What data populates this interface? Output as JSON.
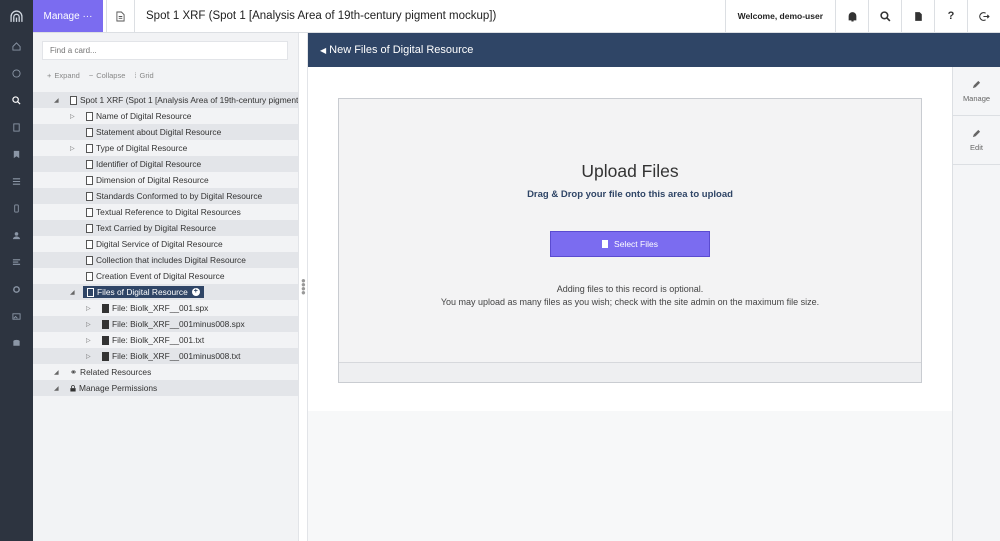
{
  "topbar": {
    "manage_label": "Manage",
    "manage_dots": "···",
    "page_title": "Spot 1 XRF (Spot 1 [Analysis Area of 19th-century pigment mockup])",
    "welcome": "Welcome, demo-user",
    "icons": [
      "bell-icon",
      "search-icon",
      "document-icon",
      "help-icon",
      "logout-icon"
    ],
    "help_glyph": "?"
  },
  "sidebar_icons": [
    "home-icon",
    "dashboard-icon",
    "search-icon",
    "notebook-icon",
    "bookmark-icon",
    "list-icon",
    "mobile-icon",
    "user-icon",
    "report-icon",
    "settings-icon",
    "image-icon",
    "database-icon"
  ],
  "tree": {
    "search_placeholder": "Find a card...",
    "expand": "Expand",
    "collapse": "Collapse",
    "grid": "Grid",
    "root": "Spot 1 XRF (Spot 1 [Analysis Area of 19th-century pigment mockup])",
    "items": [
      {
        "label": "Name of Digital Resource",
        "caret": true
      },
      {
        "label": "Statement about Digital Resource",
        "caret": false
      },
      {
        "label": "Type of Digital Resource",
        "caret": true
      },
      {
        "label": "Identifier of Digital Resource",
        "caret": false
      },
      {
        "label": "Dimension of Digital Resource",
        "caret": false
      },
      {
        "label": "Standards Conformed to by Digital Resource",
        "caret": false
      },
      {
        "label": "Textual Reference to Digital Resources",
        "caret": false
      },
      {
        "label": "Text Carried by Digital Resource",
        "caret": false
      },
      {
        "label": "Digital Service of Digital Resource",
        "caret": false
      },
      {
        "label": "Collection that includes Digital Resource",
        "caret": false
      },
      {
        "label": "Creation Event of Digital Resource",
        "caret": false
      }
    ],
    "selected": "Files of Digital Resource",
    "files": [
      "File: Biolk_XRF__001.spx",
      "File: Biolk_XRF__001minus008.spx",
      "File: Biolk_XRF__001.txt",
      "File: Biolk_XRF__001minus008.txt"
    ],
    "related": "Related Resources",
    "permissions": "Manage Permissions"
  },
  "main": {
    "header": "New Files of Digital Resource",
    "upload_title": "Upload Files",
    "upload_sub": "Drag & Drop your file onto this area to upload",
    "select_button": "Select Files",
    "note1": "Adding files to this record is optional.",
    "note2": "You may upload as many files as you wish; check with the site admin on the maximum file size."
  },
  "right_rail": {
    "manage": "Manage",
    "edit": "Edit"
  },
  "colors": {
    "accent": "#7b6cf0",
    "header_navy": "#2f4566",
    "rail": "#2d3440"
  }
}
